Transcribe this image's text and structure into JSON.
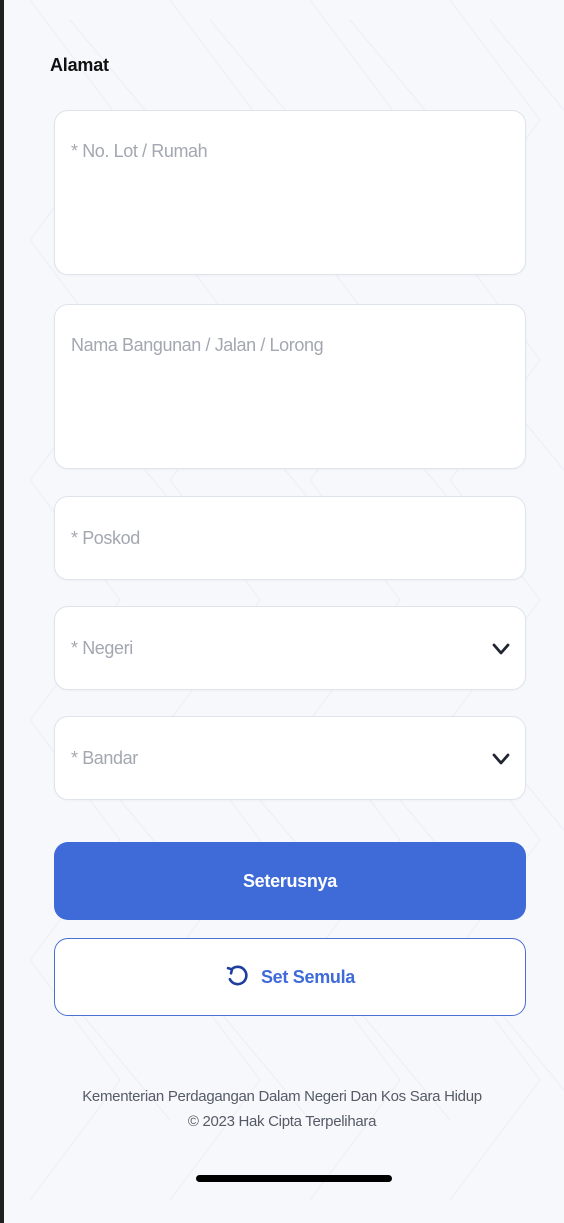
{
  "section": {
    "title": "Alamat"
  },
  "fields": {
    "lot": {
      "label": "* No. Lot / Rumah"
    },
    "building": {
      "label": "Nama Bangunan / Jalan / Lorong"
    },
    "postcode": {
      "label": "* Poskod"
    },
    "state": {
      "label": "* Negeri",
      "icon": "chevron-down-icon"
    },
    "city": {
      "label": "* Bandar",
      "icon": "chevron-down-icon"
    }
  },
  "buttons": {
    "next": {
      "label": "Seterusnya"
    },
    "reset": {
      "label": "Set Semula",
      "icon": "reset-icon"
    }
  },
  "footer": {
    "line1": "Kementerian Perdagangan Dalam Negeri Dan Kos Sara Hidup",
    "line2": "© 2023 Hak Cipta Terpelihara"
  },
  "colors": {
    "primary": "#3f6bd8",
    "background": "#f7f8fc",
    "field_border": "#dfe3ea",
    "placeholder_text": "#a3a7b0",
    "footer_text": "#555b66"
  }
}
